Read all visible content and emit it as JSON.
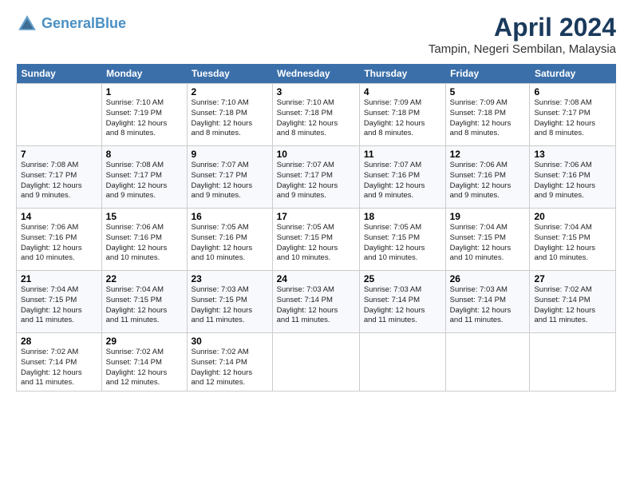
{
  "header": {
    "logo_line1": "General",
    "logo_line2": "Blue",
    "month": "April 2024",
    "location": "Tampin, Negeri Sembilan, Malaysia"
  },
  "days_of_week": [
    "Sunday",
    "Monday",
    "Tuesday",
    "Wednesday",
    "Thursday",
    "Friday",
    "Saturday"
  ],
  "weeks": [
    [
      {
        "day": "",
        "info": ""
      },
      {
        "day": "1",
        "info": "Sunrise: 7:10 AM\nSunset: 7:19 PM\nDaylight: 12 hours\nand 8 minutes."
      },
      {
        "day": "2",
        "info": "Sunrise: 7:10 AM\nSunset: 7:18 PM\nDaylight: 12 hours\nand 8 minutes."
      },
      {
        "day": "3",
        "info": "Sunrise: 7:10 AM\nSunset: 7:18 PM\nDaylight: 12 hours\nand 8 minutes."
      },
      {
        "day": "4",
        "info": "Sunrise: 7:09 AM\nSunset: 7:18 PM\nDaylight: 12 hours\nand 8 minutes."
      },
      {
        "day": "5",
        "info": "Sunrise: 7:09 AM\nSunset: 7:18 PM\nDaylight: 12 hours\nand 8 minutes."
      },
      {
        "day": "6",
        "info": "Sunrise: 7:08 AM\nSunset: 7:17 PM\nDaylight: 12 hours\nand 8 minutes."
      }
    ],
    [
      {
        "day": "7",
        "info": "Sunrise: 7:08 AM\nSunset: 7:17 PM\nDaylight: 12 hours\nand 9 minutes."
      },
      {
        "day": "8",
        "info": "Sunrise: 7:08 AM\nSunset: 7:17 PM\nDaylight: 12 hours\nand 9 minutes."
      },
      {
        "day": "9",
        "info": "Sunrise: 7:07 AM\nSunset: 7:17 PM\nDaylight: 12 hours\nand 9 minutes."
      },
      {
        "day": "10",
        "info": "Sunrise: 7:07 AM\nSunset: 7:17 PM\nDaylight: 12 hours\nand 9 minutes."
      },
      {
        "day": "11",
        "info": "Sunrise: 7:07 AM\nSunset: 7:16 PM\nDaylight: 12 hours\nand 9 minutes."
      },
      {
        "day": "12",
        "info": "Sunrise: 7:06 AM\nSunset: 7:16 PM\nDaylight: 12 hours\nand 9 minutes."
      },
      {
        "day": "13",
        "info": "Sunrise: 7:06 AM\nSunset: 7:16 PM\nDaylight: 12 hours\nand 9 minutes."
      }
    ],
    [
      {
        "day": "14",
        "info": "Sunrise: 7:06 AM\nSunset: 7:16 PM\nDaylight: 12 hours\nand 10 minutes."
      },
      {
        "day": "15",
        "info": "Sunrise: 7:06 AM\nSunset: 7:16 PM\nDaylight: 12 hours\nand 10 minutes."
      },
      {
        "day": "16",
        "info": "Sunrise: 7:05 AM\nSunset: 7:16 PM\nDaylight: 12 hours\nand 10 minutes."
      },
      {
        "day": "17",
        "info": "Sunrise: 7:05 AM\nSunset: 7:15 PM\nDaylight: 12 hours\nand 10 minutes."
      },
      {
        "day": "18",
        "info": "Sunrise: 7:05 AM\nSunset: 7:15 PM\nDaylight: 12 hours\nand 10 minutes."
      },
      {
        "day": "19",
        "info": "Sunrise: 7:04 AM\nSunset: 7:15 PM\nDaylight: 12 hours\nand 10 minutes."
      },
      {
        "day": "20",
        "info": "Sunrise: 7:04 AM\nSunset: 7:15 PM\nDaylight: 12 hours\nand 10 minutes."
      }
    ],
    [
      {
        "day": "21",
        "info": "Sunrise: 7:04 AM\nSunset: 7:15 PM\nDaylight: 12 hours\nand 11 minutes."
      },
      {
        "day": "22",
        "info": "Sunrise: 7:04 AM\nSunset: 7:15 PM\nDaylight: 12 hours\nand 11 minutes."
      },
      {
        "day": "23",
        "info": "Sunrise: 7:03 AM\nSunset: 7:15 PM\nDaylight: 12 hours\nand 11 minutes."
      },
      {
        "day": "24",
        "info": "Sunrise: 7:03 AM\nSunset: 7:14 PM\nDaylight: 12 hours\nand 11 minutes."
      },
      {
        "day": "25",
        "info": "Sunrise: 7:03 AM\nSunset: 7:14 PM\nDaylight: 12 hours\nand 11 minutes."
      },
      {
        "day": "26",
        "info": "Sunrise: 7:03 AM\nSunset: 7:14 PM\nDaylight: 12 hours\nand 11 minutes."
      },
      {
        "day": "27",
        "info": "Sunrise: 7:02 AM\nSunset: 7:14 PM\nDaylight: 12 hours\nand 11 minutes."
      }
    ],
    [
      {
        "day": "28",
        "info": "Sunrise: 7:02 AM\nSunset: 7:14 PM\nDaylight: 12 hours\nand 11 minutes."
      },
      {
        "day": "29",
        "info": "Sunrise: 7:02 AM\nSunset: 7:14 PM\nDaylight: 12 hours\nand 12 minutes."
      },
      {
        "day": "30",
        "info": "Sunrise: 7:02 AM\nSunset: 7:14 PM\nDaylight: 12 hours\nand 12 minutes."
      },
      {
        "day": "",
        "info": ""
      },
      {
        "day": "",
        "info": ""
      },
      {
        "day": "",
        "info": ""
      },
      {
        "day": "",
        "info": ""
      }
    ]
  ]
}
